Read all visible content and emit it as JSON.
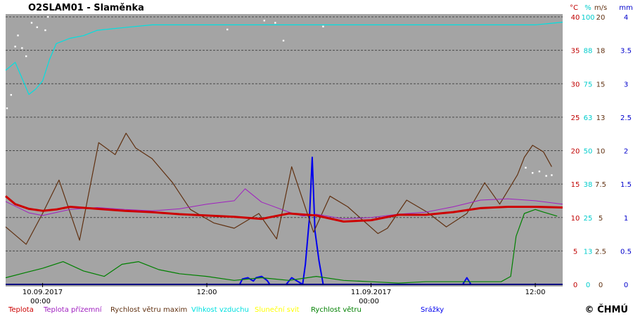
{
  "chart_data": {
    "type": "line",
    "title": "O2SLAM01 - Slaměnka",
    "copyright": "© ČHMÚ",
    "x_ticks": [
      {
        "label": "10.09.2017",
        "label2": "00:00",
        "hour": 0
      },
      {
        "label": "12:00",
        "label2": "",
        "hour": 12
      },
      {
        "label": "11.09.2017",
        "label2": "00:00",
        "hour": 24
      },
      {
        "label": "12:00",
        "label2": "",
        "hour": 36
      }
    ],
    "xlim": [
      -2.7,
      38.0
    ],
    "y_axes": [
      {
        "unit": "°C",
        "color": "#c00000",
        "values": [
          "40",
          "35",
          "30",
          "25",
          "20",
          "15",
          "10",
          "5",
          "0"
        ]
      },
      {
        "unit": "%",
        "color": "#00cccc",
        "values": [
          "100",
          "88",
          "75",
          "63",
          "50",
          "38",
          "25",
          "13",
          "0"
        ]
      },
      {
        "unit": "m/s",
        "color": "#603010",
        "values": [
          "20",
          "18",
          "15",
          "13",
          "10",
          "7.5",
          "5",
          "2.5",
          "0"
        ]
      },
      {
        "unit": "°",
        "color": "#ffffff",
        "values": [
          "360",
          "315",
          "270",
          "225",
          "180",
          "135",
          "90",
          "45",
          "0"
        ]
      },
      {
        "unit": "mm",
        "color": "#0000cc",
        "values": [
          "4",
          "3.5",
          "3",
          "2.5",
          "2",
          "1.5",
          "1",
          "0.5",
          "0"
        ]
      }
    ],
    "legend": [
      {
        "label": "Teplota",
        "color": "#cc0000"
      },
      {
        "label": "Teplota přízemní",
        "color": "#a020c0"
      },
      {
        "label": "Rychlost větru maxim",
        "color": "#603010"
      },
      {
        "label": "Vlhkost vzduchu",
        "color": "#00e0e0"
      },
      {
        "label": "Sluneční svit",
        "color": "#ffff00"
      },
      {
        "label": "Rychlost větru",
        "color": "#008000"
      },
      {
        "label": "Směr větru",
        "color": "#ffffff"
      },
      {
        "label": "Srážky",
        "color": "#0000ee"
      }
    ],
    "series": [
      {
        "name": "Teplota",
        "unit": "°C",
        "color": "#cc0000",
        "x": [
          -2.7,
          -2,
          -1,
          0,
          1,
          2,
          4,
          6,
          8,
          10,
          12,
          14,
          16,
          18,
          20,
          22,
          24,
          26,
          28,
          30,
          32,
          34,
          36,
          38
        ],
        "y": [
          13.2,
          12.0,
          11.3,
          11.0,
          11.2,
          11.6,
          11.3,
          11.0,
          10.8,
          10.5,
          10.3,
          10.1,
          9.8,
          10.6,
          10.3,
          9.4,
          9.6,
          10.4,
          10.4,
          10.8,
          11.4,
          11.6,
          11.6,
          11.5
        ]
      },
      {
        "name": "Teplota přízemní",
        "unit": "°C",
        "color": "#a020c0",
        "x": [
          -2.7,
          -1,
          0,
          2,
          4,
          6,
          8,
          10,
          12,
          14,
          14.8,
          16,
          18,
          19,
          20,
          22,
          24,
          26,
          28,
          30,
          32,
          34,
          36,
          38
        ],
        "y": [
          12.4,
          10.7,
          10.3,
          11.2,
          11.5,
          11.2,
          11.0,
          11.3,
          12.0,
          12.5,
          14.3,
          12.3,
          10.8,
          10.2,
          10.5,
          9.8,
          10.0,
          10.5,
          10.8,
          11.6,
          12.6,
          12.8,
          12.5,
          12.0
        ]
      },
      {
        "name": "Vlhkost vzduchu",
        "unit": "%",
        "color": "#00e0e0",
        "x": [
          -2.7,
          -2,
          -1.5,
          -1,
          -0.5,
          0,
          0.5,
          1,
          2,
          3,
          4,
          6,
          8,
          12,
          16,
          20,
          24,
          28,
          32,
          36,
          37,
          38
        ],
        "y": [
          80,
          83,
          77,
          71,
          73,
          76,
          84,
          90,
          92,
          93,
          95,
          96,
          97,
          97,
          97,
          97,
          97,
          97,
          97,
          97,
          97.5,
          98
        ]
      },
      {
        "name": "Rychlost větru maxim",
        "unit": "m/s",
        "color": "#603010",
        "x": [
          -2.7,
          -1.2,
          0,
          1.2,
          2.7,
          4.1,
          5.3,
          6.1,
          6.8,
          8.0,
          9.5,
          10.8,
          12.5,
          14.0,
          15.8,
          17.1,
          18.2,
          19.8,
          21.0,
          22.3,
          24.5,
          25.2,
          26.6,
          28.1,
          29.5,
          31.0,
          32.3,
          33.4,
          34.7,
          35.2,
          35.8,
          36.6,
          37.2
        ],
        "y": [
          4.3,
          3.0,
          5.3,
          7.8,
          3.3,
          10.6,
          9.7,
          11.3,
          10.2,
          9.4,
          7.6,
          5.6,
          4.6,
          4.2,
          5.3,
          3.4,
          8.8,
          3.9,
          6.6,
          5.8,
          3.8,
          4.2,
          6.3,
          5.4,
          4.3,
          5.3,
          7.6,
          6.0,
          8.2,
          9.5,
          10.4,
          9.9,
          8.8
        ]
      },
      {
        "name": "Rychlost větru",
        "unit": "m/s",
        "color": "#008000",
        "x": [
          -2.7,
          -1.2,
          0,
          1.5,
          3,
          4.5,
          5.8,
          7.0,
          8.5,
          10,
          12,
          14,
          16,
          18,
          20,
          22,
          24,
          26,
          28,
          30,
          32,
          33.5,
          34.2,
          34.6,
          35.2,
          36,
          36.6,
          37.6
        ],
        "y": [
          0.5,
          0.9,
          1.2,
          1.7,
          1.0,
          0.6,
          1.5,
          1.7,
          1.1,
          0.8,
          0.6,
          0.3,
          0.5,
          0.3,
          0.6,
          0.3,
          0.2,
          0.1,
          0.2,
          0.2,
          0.2,
          0.2,
          0.6,
          3.6,
          5.3,
          5.6,
          5.4,
          5.1
        ]
      },
      {
        "name": "Směr větru",
        "unit": "°",
        "color": "#ffffff",
        "x": [
          -2.6,
          -2.3,
          -2.0,
          -1.8,
          -1.5,
          -1.2,
          -0.8,
          -0.4,
          0.2,
          0.4,
          13.5,
          16.2,
          17.0,
          17.6,
          20.5,
          35.3,
          35.8,
          36.3,
          36.8,
          37.2
        ],
        "y": [
          237,
          255,
          320,
          335,
          318,
          307,
          352,
          346,
          342,
          360,
          343,
          355,
          352,
          328,
          347,
          157,
          150,
          152,
          146,
          147
        ]
      },
      {
        "name": "Srážky",
        "unit": "mm",
        "color": "#0000ee",
        "x": [
          -2.7,
          14.4,
          14.6,
          15.0,
          15.4,
          15.6,
          16.0,
          16.4,
          16.6,
          17.8,
          18.2,
          19.0,
          19.2,
          19.5,
          19.7,
          19.9,
          20.2,
          20.5,
          21.0,
          24,
          30.7,
          31.0,
          31.3,
          38
        ],
        "y": [
          0,
          0,
          0.08,
          0.1,
          0.05,
          0.1,
          0.12,
          0.06,
          0,
          0,
          0.1,
          0,
          0.3,
          1.0,
          1.9,
          0.8,
          0.35,
          0,
          0,
          0,
          0,
          0.1,
          0,
          0
        ]
      }
    ]
  }
}
